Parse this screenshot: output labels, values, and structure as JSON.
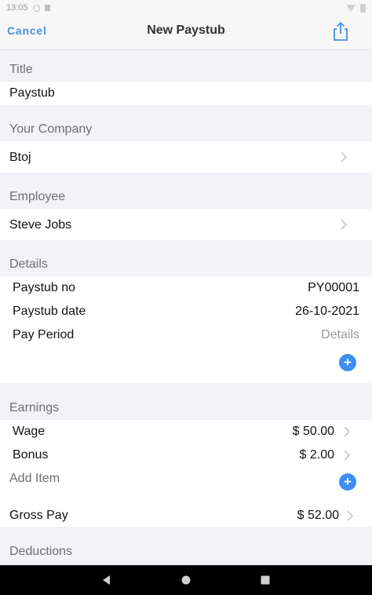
{
  "status_bar": {
    "time": "13:05"
  },
  "nav": {
    "cancel_label": "Cancel",
    "title": "New Paystub",
    "share_icon": "share-icon"
  },
  "sections": {
    "title": {
      "header": "Title",
      "value": "Paystub"
    },
    "company": {
      "header": "Your Company",
      "value": "Btoj"
    },
    "employee": {
      "header": "Employee",
      "value": "Steve Jobs"
    },
    "details": {
      "header": "Details",
      "paystub_no_label": "Paystub no",
      "paystub_no_value": "PY00001",
      "paystub_date_label": "Paystub date",
      "paystub_date_value": "26-10-2021",
      "pay_period_label": "Pay Period",
      "pay_period_value": "Details"
    },
    "earnings": {
      "header": "Earnings",
      "items": [
        {
          "label": "Wage",
          "value": "$ 50.00"
        },
        {
          "label": "Bonus",
          "value": "$ 2.00"
        }
      ],
      "add_item_label": "Add Item",
      "gross_pay_label": "Gross Pay",
      "gross_pay_value": "$ 52.00"
    },
    "deductions": {
      "header": "Deductions"
    }
  },
  "colors": {
    "accent": "#4a90e2",
    "plus_button": "#3d8ef5",
    "background": "#f2f2f7"
  }
}
